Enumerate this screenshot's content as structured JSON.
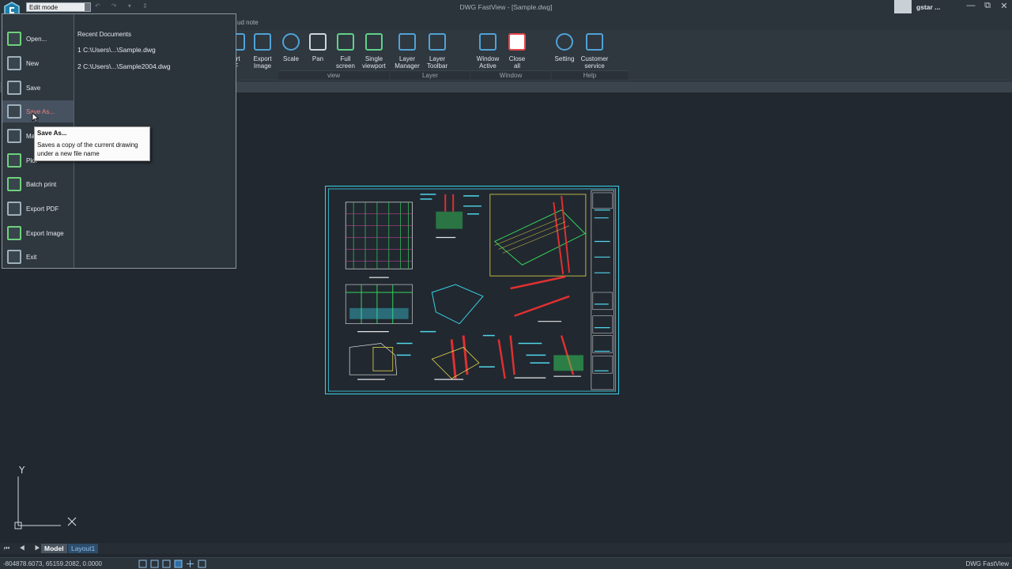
{
  "window": {
    "title": "DWG FastView - [Sample.dwg]",
    "mode": "Edit mode",
    "user": "gstar ...",
    "controls": [
      "—",
      "⧉",
      "✕"
    ]
  },
  "ribbon": {
    "tab_visible": "ud note",
    "buttons": [
      {
        "label": "ort\nF"
      },
      {
        "label": "Export\nImage"
      },
      {
        "label": "Scale"
      },
      {
        "label": "Pan"
      },
      {
        "label": "Full\nscreen"
      },
      {
        "label": "Single\nviewport"
      },
      {
        "label": "Layer\nManager"
      },
      {
        "label": "Layer\nToolbar"
      },
      {
        "label": "Window\nActive"
      },
      {
        "label": "Close\nall"
      },
      {
        "label": "Setting"
      },
      {
        "label": "Customer\nservice"
      }
    ],
    "groups": {
      "view": "view",
      "layer": "Layer",
      "window": "Window",
      "help": "Help"
    },
    "doc_controls": "— ⧉ ✕"
  },
  "app_menu": {
    "items": [
      {
        "label": "Open...",
        "icon": "open-icon"
      },
      {
        "label": "New",
        "icon": "new-icon"
      },
      {
        "label": "Save",
        "icon": "save-icon"
      },
      {
        "label": "Save As...",
        "icon": "save-as-icon"
      },
      {
        "label": "Ma",
        "icon": "mail-icon"
      },
      {
        "label": "Plot",
        "icon": "plot-icon"
      },
      {
        "label": "Batch print",
        "icon": "batch-print-icon"
      },
      {
        "label": "Export PDF",
        "icon": "export-pdf-icon"
      },
      {
        "label": "Export Image",
        "icon": "export-image-icon"
      },
      {
        "label": "Exit",
        "icon": "exit-icon"
      }
    ],
    "recent_title": "Recent Documents",
    "recent": [
      "1 C:\\Users\\...\\Sample.dwg",
      "2 C:\\Users\\...\\Sample2004.dwg"
    ]
  },
  "tooltip": {
    "title": "Save As...",
    "body": "Saves a copy of the current drawing under a new file name"
  },
  "layout_tabs": {
    "nav": "⏮ ◀ ▶ ⏭",
    "model": "Model",
    "layout1": "Layout1"
  },
  "status": {
    "coords": "-804878.6073, 65159.2082, 0.0000",
    "app": "DWG FastView"
  },
  "colors": {
    "accent": "#4fa3d6",
    "drawing_frame": "#3bd1e6",
    "canvas": "#212830"
  }
}
